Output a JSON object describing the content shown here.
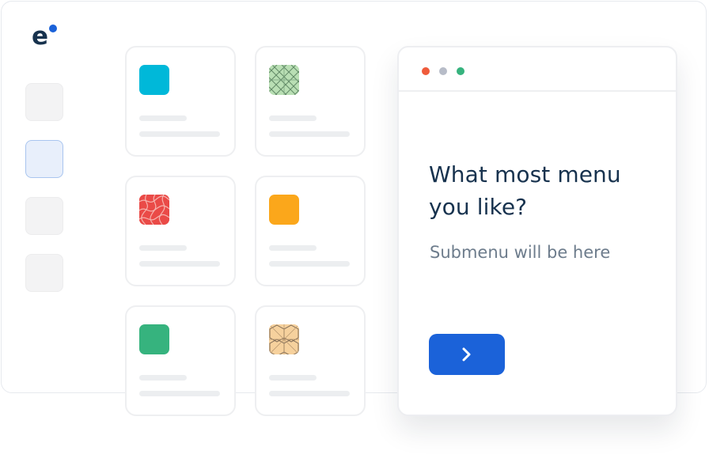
{
  "brand": {
    "logo_icon": "e-logo-icon",
    "accent_color": "#1b62d9"
  },
  "sidebar": {
    "items": [
      {
        "state": "inactive"
      },
      {
        "state": "active"
      },
      {
        "state": "inactive"
      },
      {
        "state": "inactive"
      }
    ]
  },
  "menu_cards": [
    {
      "icon": "cyan-square-icon",
      "color": "#00b8d9"
    },
    {
      "icon": "green-diamond-pattern-icon",
      "color": "#b9dfb4"
    },
    {
      "icon": "red-curve-pattern-icon",
      "color": "#ea4a47"
    },
    {
      "icon": "orange-square-icon",
      "color": "#fba71b"
    },
    {
      "icon": "green-square-icon",
      "color": "#36b37e"
    },
    {
      "icon": "peach-hexagon-pattern-icon",
      "color": "#f6d19d"
    }
  ],
  "window": {
    "controls": [
      {
        "name": "close-dot",
        "color": "#ef5b3b"
      },
      {
        "name": "minimize-dot",
        "color": "#b7bcc8"
      },
      {
        "name": "maximize-dot",
        "color": "#36b37e"
      }
    ]
  },
  "popup": {
    "title": "What most menu you like?",
    "subtitle": "Submenu will be here",
    "next_icon": "chevron-right-icon"
  }
}
